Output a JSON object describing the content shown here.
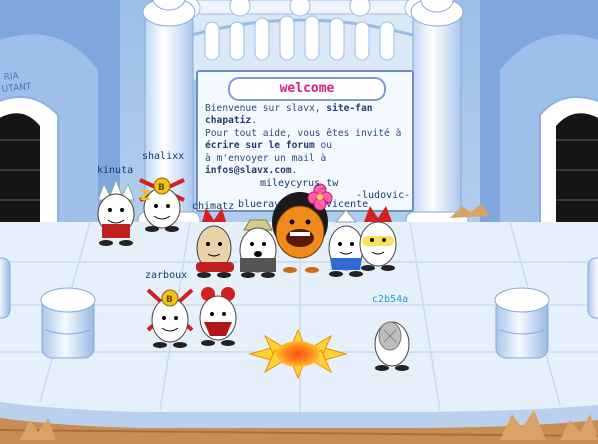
{
  "welcome_board": {
    "title": "welcome",
    "lines": [
      [
        "Bienvenue sur slavx, ",
        "site-fan"
      ],
      [
        "chapatiz",
        "."
      ],
      [
        "Pour tout aide, vous êtes invité à",
        ""
      ],
      [
        "écrire sur le forum",
        " ou"
      ],
      [
        "à m'envoyer un mail à",
        ""
      ],
      [
        "infos@slavx.com",
        "."
      ]
    ]
  },
  "wall_sign": "RIA\nUTANT",
  "players": [
    {
      "name": "kinuta"
    },
    {
      "name": "shalixx"
    },
    {
      "name": "mileycyrus_tw"
    },
    {
      "name": "chimatz"
    },
    {
      "name": "blueray"
    },
    {
      "name": "vicente"
    },
    {
      "name": "-ludovic-"
    },
    {
      "name": "zarboux"
    },
    {
      "name": "c2b54a"
    }
  ],
  "colors": {
    "sky": "#a9c9ec",
    "floor": "#e6f0fb",
    "board_title": "#d3227d",
    "name_text": "#163a6a",
    "self_name": "#1e9fd2",
    "wood": "#c98d52"
  }
}
